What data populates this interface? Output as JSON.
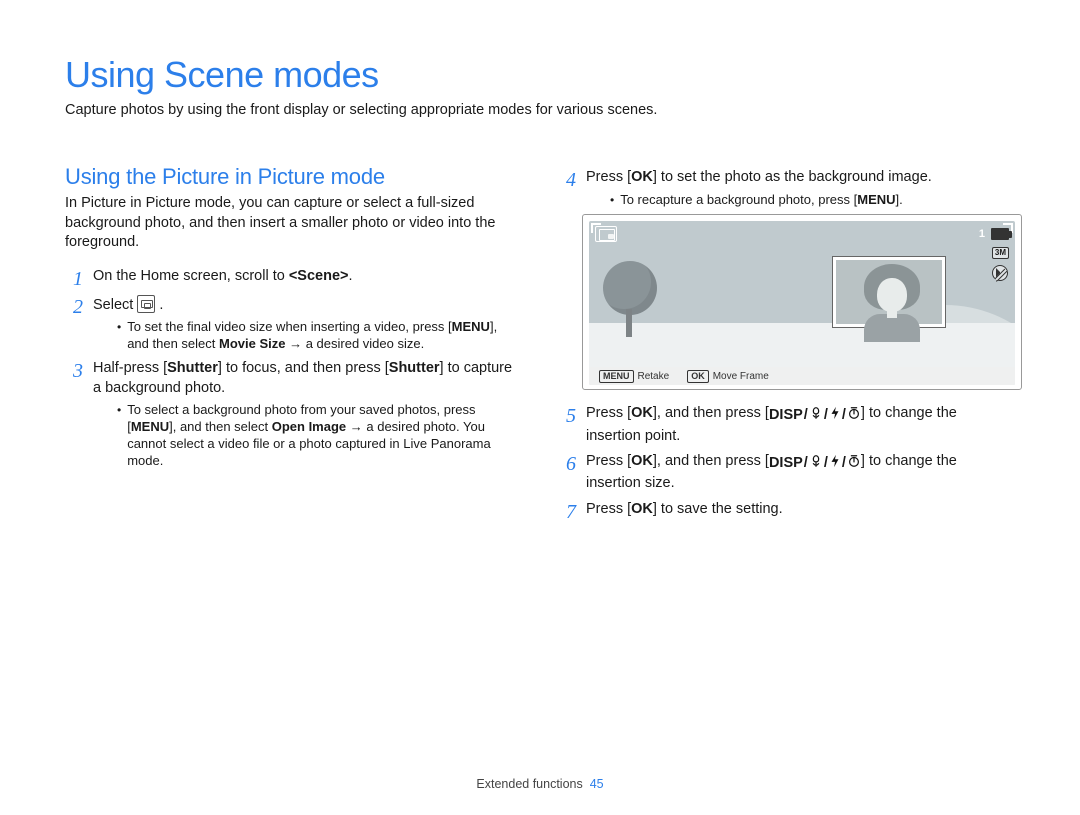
{
  "page": {
    "title": "Using Scene modes",
    "subtitle": "Capture photos by using the front display or selecting appropriate modes for various scenes.",
    "footer_section": "Extended functions",
    "footer_page": "45"
  },
  "left": {
    "h2": "Using the Picture in Picture mode",
    "intro": "In Picture in Picture mode, you can capture or select a full-sized background photo, and then insert a smaller photo or video into the foreground.",
    "steps": {
      "s1": {
        "num": "1",
        "body_parts": [
          "On the Home screen, scroll to ",
          "<Scene>",
          "."
        ]
      },
      "s2": {
        "num": "2",
        "body_parts": [
          "Select ",
          " ."
        ],
        "sub_parts": {
          "a": "To set the final video size when inserting a video, press [",
          "b": "], and then select ",
          "c": "Movie Size",
          "d": " → a desired video size."
        }
      },
      "s3": {
        "num": "3",
        "body_parts": [
          "Half-press [",
          "Shutter",
          "] to focus, and then press [",
          "Shutter",
          "] to capture a background photo."
        ],
        "sub_parts": {
          "a": "To select a background photo from your saved photos, press [",
          "b": "], and then select ",
          "c": "Open Image",
          "d": " → a desired photo. You cannot select a video file or a photo captured in Live Panorama mode."
        }
      }
    }
  },
  "right": {
    "steps": {
      "s4": {
        "num": "4",
        "body_parts": [
          "Press [",
          "] to set the photo as the background image."
        ],
        "sub_parts": {
          "a": "To recapture a background photo, press [",
          "b": "]."
        }
      },
      "s5": {
        "num": "5",
        "body_parts": [
          "Press [",
          "], and then press [",
          "] to change the insertion point."
        ]
      },
      "s6": {
        "num": "6",
        "body_parts": [
          "Press [",
          "], and then press [",
          "] to change the insertion size."
        ]
      },
      "s7": {
        "num": "7",
        "body_parts": [
          "Press [",
          "] to save the setting."
        ]
      }
    }
  },
  "buttons": {
    "ok": "OK",
    "menu": "MENU",
    "disp": "DISP"
  },
  "lcd": {
    "counter": "1",
    "size_badge": "3M",
    "retake": "Retake",
    "move_frame": "Move Frame",
    "menu_tag": "MENU",
    "ok_tag": "OK"
  }
}
